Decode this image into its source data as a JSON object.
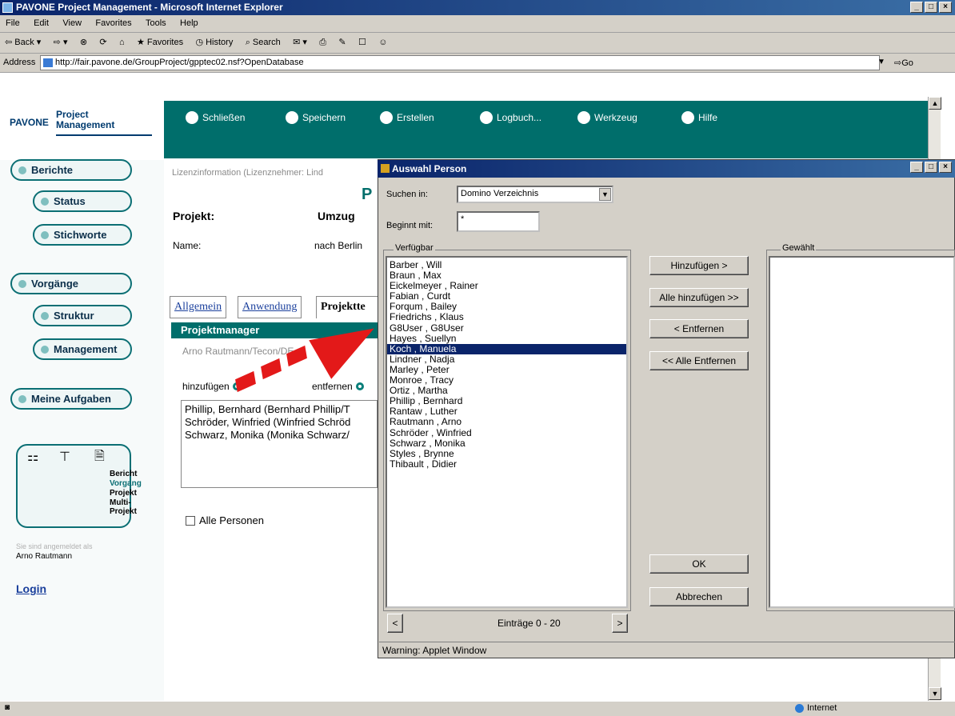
{
  "window": {
    "title": "PAVONE Project Management - Microsoft Internet Explorer"
  },
  "menu": [
    "File",
    "Edit",
    "View",
    "Favorites",
    "Tools",
    "Help"
  ],
  "toolbar": {
    "back": "Back",
    "favorites": "Favorites",
    "history": "History",
    "search": "Search"
  },
  "address": {
    "label": "Address",
    "url": "http://fair.pavone.de/GroupProject/gpptec02.nsf?OpenDatabase",
    "go": "Go"
  },
  "app": {
    "logo": {
      "brand": "PAVONE",
      "product_line1": "Project",
      "product_line2": "Management"
    },
    "top_buttons": [
      "Schließen",
      "Speichern",
      "Erstellen",
      "Logbuch...",
      "Werkzeug",
      "Hilfe"
    ],
    "nav": {
      "berichte": "Berichte",
      "status": "Status",
      "stichworte": "Stichworte",
      "vorgaenge": "Vorgänge",
      "struktur": "Struktur",
      "management": "Management",
      "meine_aufgaben": "Meine Aufgaben"
    },
    "view_box": {
      "bericht": "Bericht",
      "vorgang": "Vorgang",
      "projekt": "Projekt",
      "multi1": "Multi-",
      "multi2": "Projekt"
    },
    "logged_in_label": "Sie sind angemeldet als",
    "logged_in_name": "Arno Rautmann",
    "login": "Login"
  },
  "content": {
    "license": "Lizenzinformation (Lizenznehmer: Lind",
    "p_letter": "P",
    "projekt_label": "Projekt:",
    "projekt_value": "Umzug",
    "name_label": "Name:",
    "name_value": "nach Berlin",
    "tabs": [
      "Allgemein",
      "Anwendung",
      "Projektte"
    ],
    "pm_header": "Projektmanager",
    "pm_name": "Arno Rautmann/Tecon/DE",
    "add_label": "hinzufügen",
    "remove_label": "entfernen",
    "pm_list": [
      "Phillip, Bernhard (Bernhard Phillip/T",
      "Schröder, Winfried (Winfried Schröd",
      "Schwarz, Monika (Monika Schwarz/"
    ],
    "alle_personen": "Alle Personen"
  },
  "dialog": {
    "title": "Auswahl Person",
    "suchen_label": "Suchen in:",
    "suchen_value": "Domino Verzeichnis",
    "beginnt_label": "Beginnt mit:",
    "beginnt_value": "*",
    "available_title": "Verfügbar",
    "chosen_title": "Gewählt",
    "available": [
      "Barber , Will",
      "Braun , Max",
      "Eickelmeyer , Rainer",
      "Fabian , Curdt",
      "Forqum , Bailey",
      "Friedrichs , Klaus",
      "G8User , G8User",
      "Hayes , Suellyn",
      "Koch , Manuela",
      "Lindner , Nadja",
      "Marley , Peter",
      "Monroe , Tracy",
      "Ortiz , Martha",
      "Phillip , Bernhard",
      "Rantaw , Luther",
      "Rautmann , Arno",
      "Schröder , Winfried",
      "Schwarz , Monika",
      "Styles , Brynne",
      "Thibault , Didier"
    ],
    "selected_item": "Koch , Manuela",
    "buttons": {
      "add": "Hinzufügen >",
      "add_all": "Alle hinzufügen >>",
      "remove": "< Entfernen",
      "remove_all": "<< Alle Entfernen",
      "ok": "OK",
      "cancel": "Abbrechen"
    },
    "prev": "<",
    "next": ">",
    "count": "Einträge 0 - 20",
    "warning": "Warning: Applet Window"
  },
  "status": {
    "zone": "Internet"
  }
}
